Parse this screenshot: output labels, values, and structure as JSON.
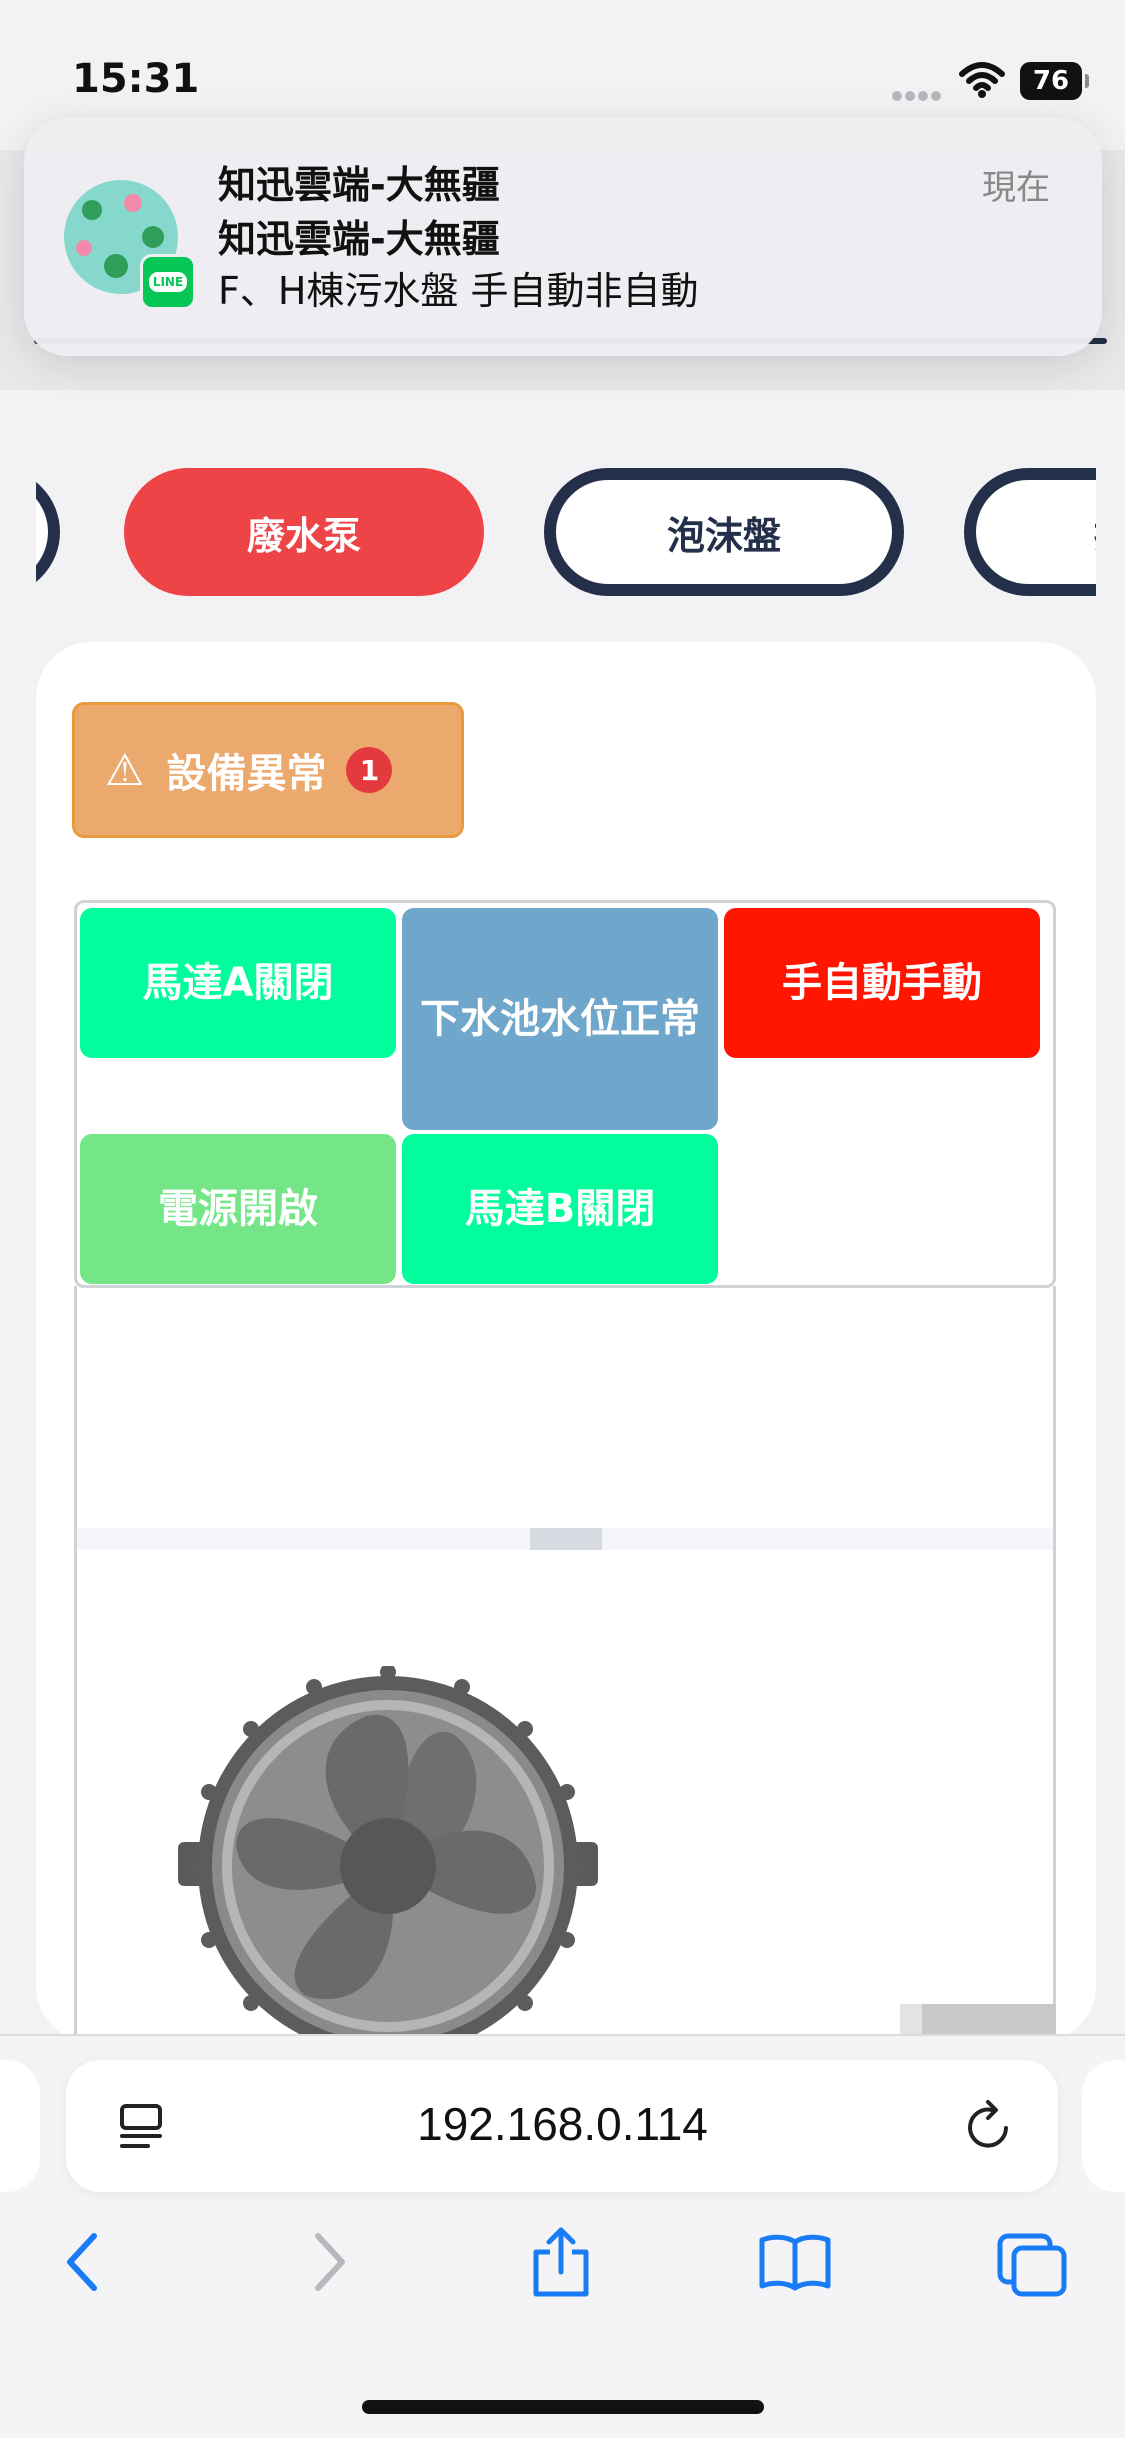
{
  "status_bar": {
    "time": "15:31",
    "battery": "76"
  },
  "notification": {
    "title": "知迅雲端-大無疆",
    "subtitle": "知迅雲端-大無疆",
    "body": "F、H棟污水盤 手自動非自動",
    "time": "現在",
    "app_badge": "LINE"
  },
  "tabs": [
    {
      "label": "廢水泵",
      "active": true
    },
    {
      "label": "泡沫盤",
      "active": false
    },
    {
      "label": "抽",
      "active": false
    }
  ],
  "alert": {
    "label": "設備異常",
    "count": "1",
    "color": "#eca96e"
  },
  "status_cells": [
    {
      "label": "馬達A關閉",
      "color": "#02fd9d"
    },
    {
      "label": "下水池水位正常",
      "color": "#6fa6cb"
    },
    {
      "label": "手自動手動",
      "color": "#ff1500"
    },
    {
      "label": "電源開啟",
      "color": "#75e688"
    },
    {
      "label": "馬達B關閉",
      "color": "#02fd9d"
    }
  ],
  "browser": {
    "url": "192.168.0.114"
  },
  "colors": {
    "accent_red": "#ef4447",
    "navy": "#24304a",
    "line_green": "#06c755"
  }
}
